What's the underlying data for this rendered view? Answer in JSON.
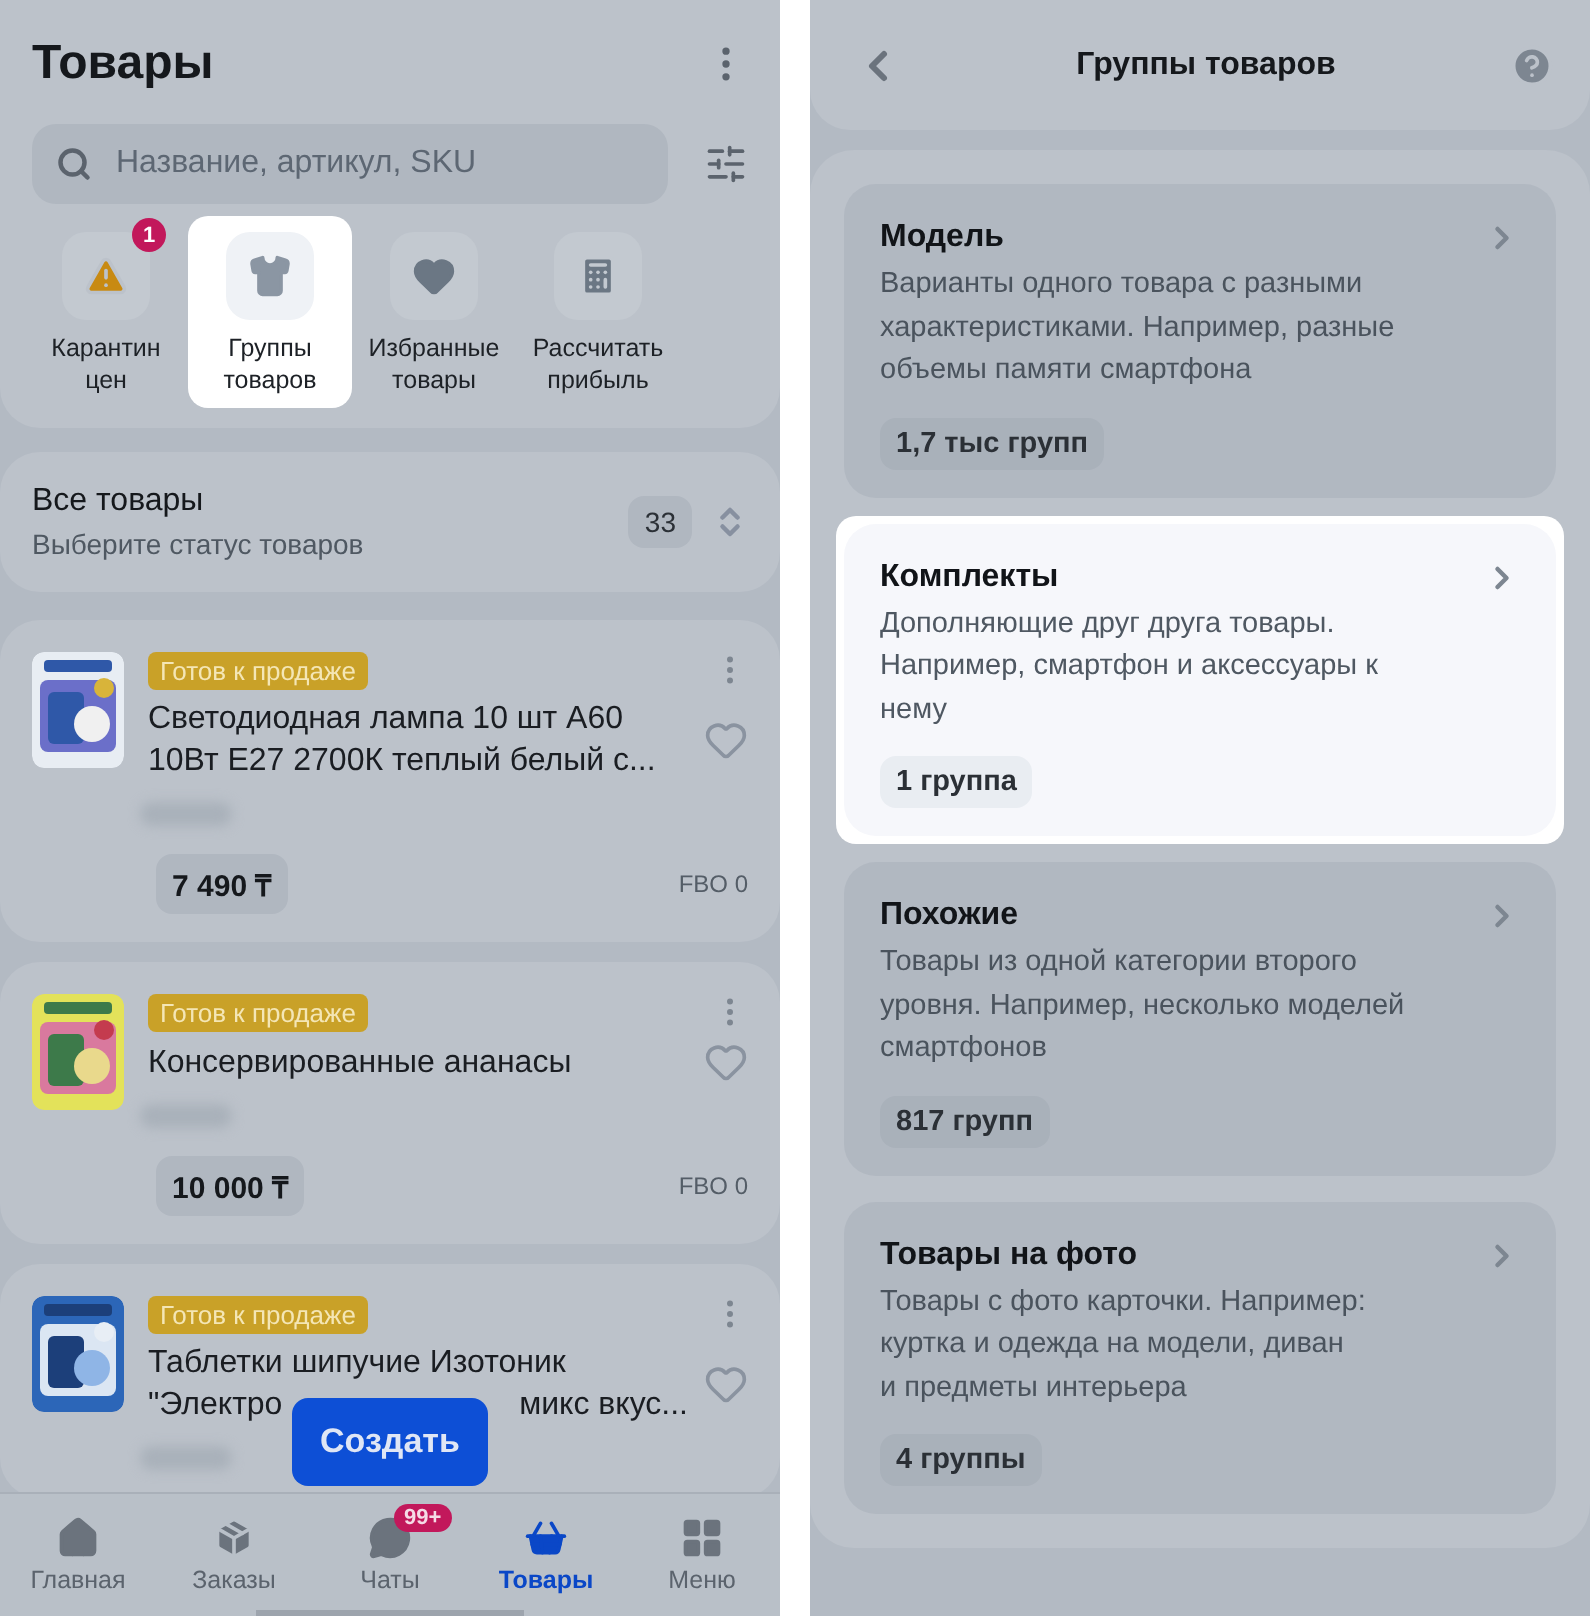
{
  "products_screen": {
    "title": "Товары",
    "search": {
      "placeholder": "Название, артикул, SKU"
    },
    "quick_actions": [
      {
        "label": "Карантин цен",
        "badge": "1",
        "highlighted": false
      },
      {
        "label": "Группы товаров",
        "highlighted": true
      },
      {
        "label": "Избранные товары",
        "highlighted": false
      },
      {
        "label": "Рассчитать прибыль",
        "highlighted": false
      }
    ],
    "status_filter": {
      "title": "Все товары",
      "subtitle": "Выберите статус товаров",
      "count": "33"
    },
    "products": [
      {
        "status": "Готов к продаже",
        "lines": [
          [
            "Светодиодная лампа 10 шт А60"
          ],
          [
            "10Вт Е27 2700К теплый белый с..."
          ]
        ],
        "price": "7 490 ₸",
        "stock": "FBO 0"
      },
      {
        "status": "Готов к продаже",
        "lines": [
          [
            "Консервированные ананасы"
          ]
        ],
        "price": "10 000 ₸",
        "stock": "FBO 0"
      },
      {
        "status": "Готов к продаже",
        "lines": [
          [
            "Таблетки шипучие Изотоник"
          ],
          [
            "\"Электро",
            "микс вкус..."
          ]
        ]
      }
    ],
    "create_button": "Создать",
    "nav": [
      {
        "label": "Главная",
        "selected": false
      },
      {
        "label": "Заказы",
        "selected": false
      },
      {
        "label": "Чаты",
        "badge": "99+",
        "selected": false
      },
      {
        "label": "Товары",
        "selected": true
      },
      {
        "label": "Меню",
        "selected": false
      }
    ]
  },
  "groups_screen": {
    "title": "Группы товаров",
    "groups": [
      {
        "title": "Модель",
        "description": "Варианты одного товара с разными\nхарактеристиками. Например, разные\nобъемы памяти смартфона",
        "count": "1,7 тыс групп",
        "highlighted": false
      },
      {
        "title": "Комплекты",
        "description": "Дополняющие друг друга товары.\nНапример, смартфон и аксессуары к\nнему",
        "count": "1 группа",
        "highlighted": true
      },
      {
        "title": "Похожие",
        "description": "Товары из одной категории второго\nуровня. Например, несколько моделей\nсмартфонов",
        "count": "817 групп",
        "highlighted": false
      },
      {
        "title": "Товары на фото",
        "description": "Товары с фото карточки. Например:\nкуртка и одежда на модели, диван\nи предметы интерьера",
        "count": "4 группы",
        "highlighted": false
      }
    ]
  }
}
